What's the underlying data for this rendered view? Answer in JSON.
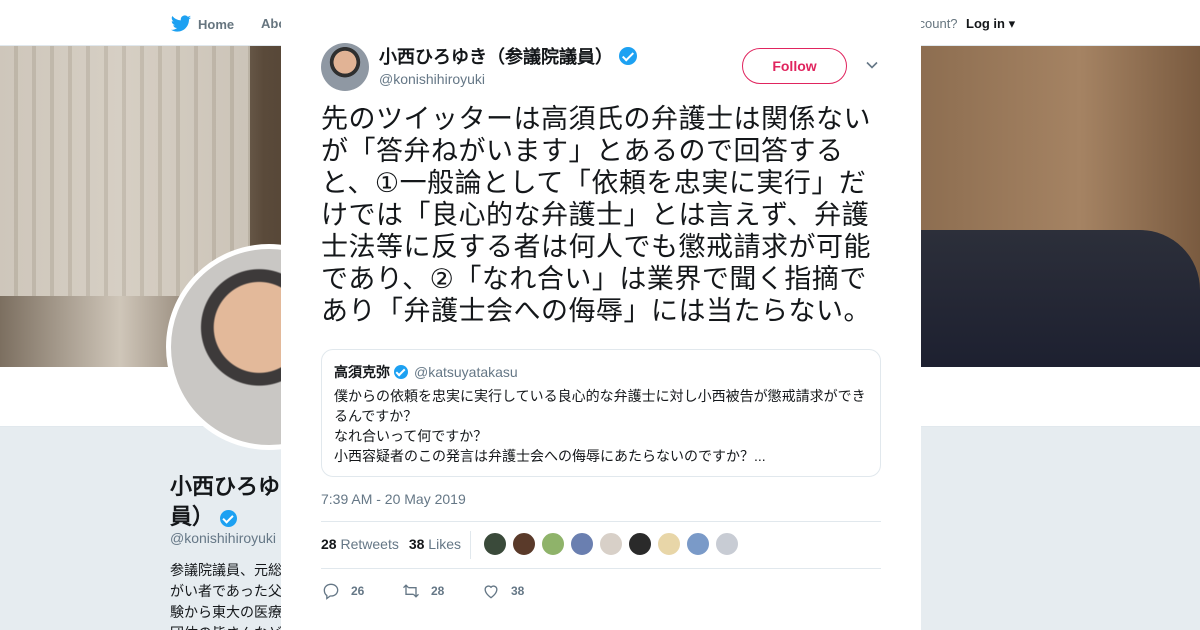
{
  "background": {
    "nav": {
      "home": "Home",
      "about": "Abo",
      "account": "ccount?",
      "login": "Log in"
    },
    "profile": {
      "name": "小西ひろゆ員）",
      "handle": "@konishihiroyuki",
      "bio": "参議院議員、元総がい者であった父験から東大の医療団体の皆さんなど"
    }
  },
  "modal": {
    "author": {
      "name": "小西ひろゆき（参議院議員）",
      "handle": "@konishihiroyuki"
    },
    "follow_label": "Follow",
    "tweet_text": "先のツイッターは高須氏の弁護士は関係ないが「答弁ねがいます」とあるので回答すると、①一般論として「依頼を忠実に実行」だけでは「良心的な弁護士」とは言えず、弁護士法等に反する者は何人でも懲戒請求が可能であり、②「なれ合い」は業界で聞く指摘であり「弁護士会への侮辱」には当たらない。",
    "quote": {
      "name": "高須克弥",
      "handle": "@katsuyatakasu",
      "lines": [
        "僕からの依頼を忠実に実行している良心的な弁護士に対し小西被告が懲戒請求ができ",
        "るんですか？",
        "なれ合いって何ですか？",
        "小西容疑者のこの発言は弁護士会への侮辱にあたらないのですか？..."
      ]
    },
    "timestamp": "7:39 AM - 20 May 2019",
    "stats": {
      "retweets": "28",
      "retweets_label": "Retweets",
      "likes": "38",
      "likes_label": "Likes"
    },
    "liker_colors": [
      "#3a4a3a",
      "#5a3a2a",
      "#8fb36a",
      "#6a7fb0",
      "#d8d0c8",
      "#2a2a2a",
      "#e8d6a8",
      "#7a9ac8",
      "#c8ccd4"
    ],
    "actions": {
      "replies": "26",
      "retweets": "28",
      "likes": "38"
    }
  },
  "colors": {
    "accent": "#1da1f2",
    "follow": "#e0245e"
  }
}
